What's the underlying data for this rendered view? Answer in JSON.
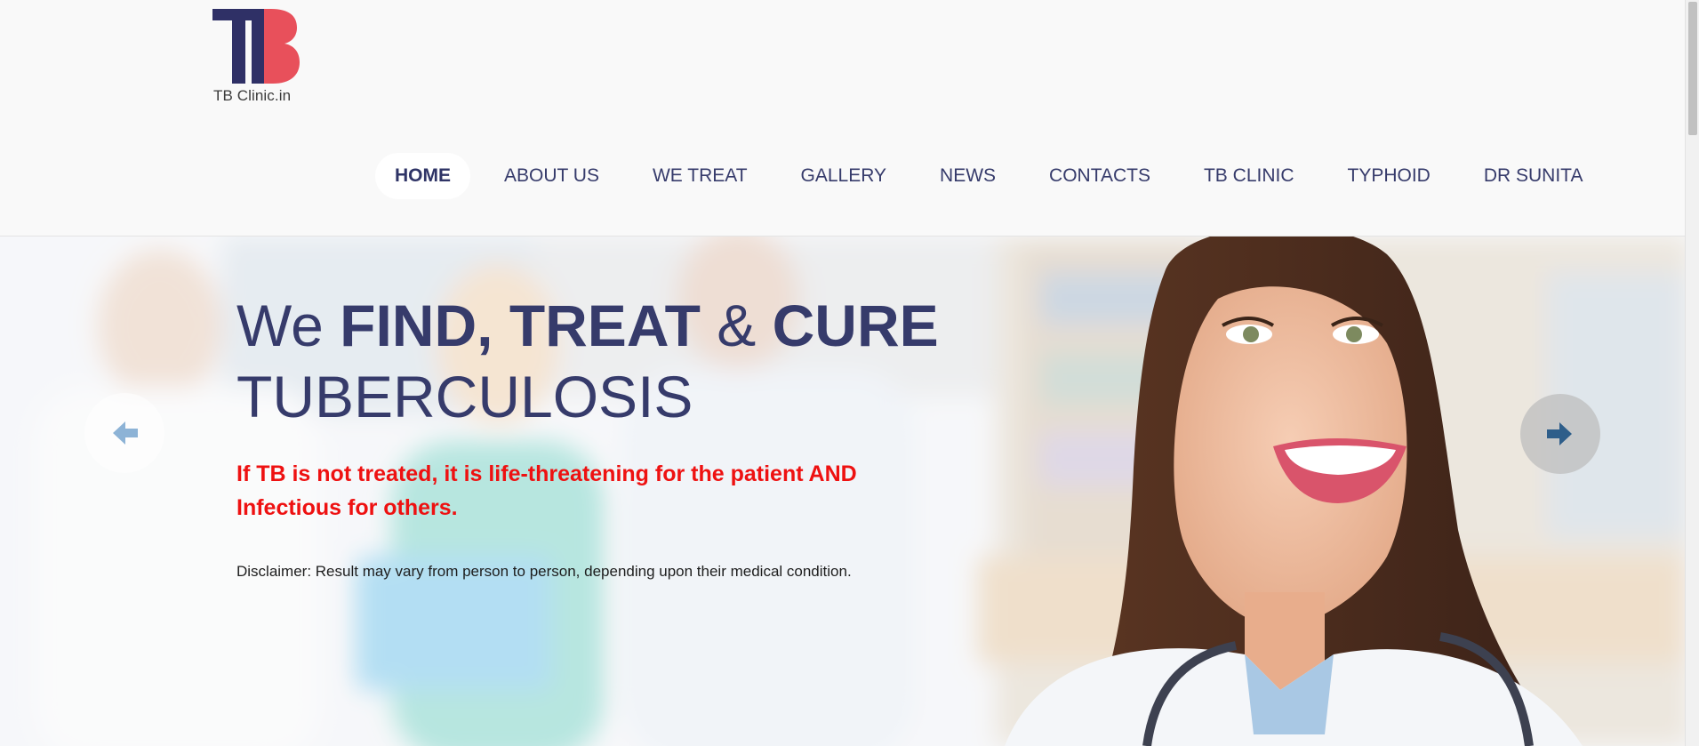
{
  "logo": {
    "mark_letters": "TB",
    "text": "TB Clinic.in",
    "colors": {
      "t": "#2f3066",
      "b": "#e8505b"
    }
  },
  "nav": {
    "items": [
      {
        "label": "HOME",
        "active": true
      },
      {
        "label": "ABOUT US"
      },
      {
        "label": "WE TREAT"
      },
      {
        "label": "GALLERY"
      },
      {
        "label": "NEWS"
      },
      {
        "label": "CONTACTS"
      },
      {
        "label": "TB CLINIC"
      },
      {
        "label": "TYPHOID"
      },
      {
        "label": "DR SUNITA"
      }
    ]
  },
  "hero": {
    "title_we": "We",
    "title_find": "FIND,",
    "title_treat": "TREAT",
    "title_amp": "&",
    "title_cure": "CURE",
    "title_line2": "TUBERCULOSIS",
    "alert": "If TB is not treated, it is life-threatening for the patient AND Infectious for others.",
    "disclaimer": "Disclaimer: Result may vary from person to person, depending upon their medical condition.",
    "prev_icon": "arrow-left-icon",
    "next_icon": "arrow-right-icon"
  },
  "colors": {
    "nav_text": "#363b6b",
    "title": "#363b6b",
    "alert": "#ee1111",
    "header_bg": "#f9f9f9"
  }
}
